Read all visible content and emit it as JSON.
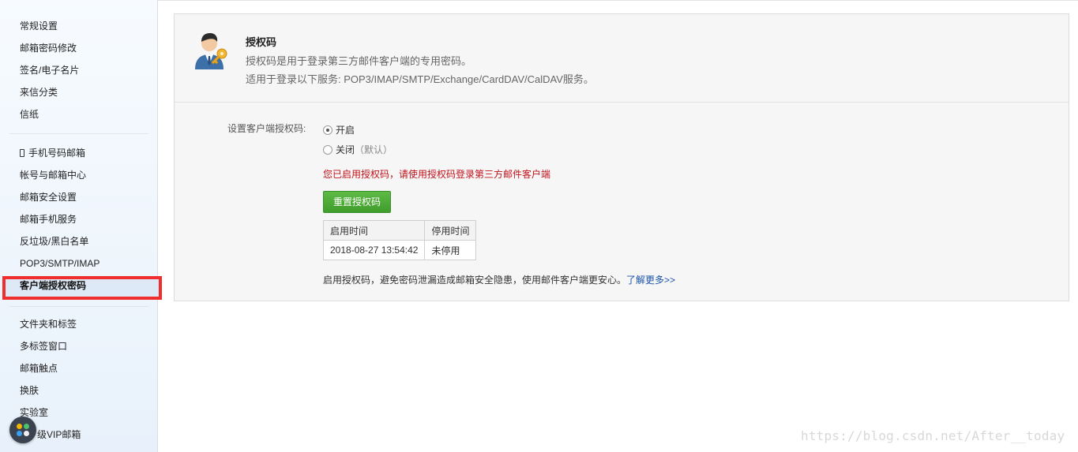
{
  "sidebar": {
    "group1": [
      "常规设置",
      "邮箱密码修改",
      "签名/电子名片",
      "来信分类",
      "信纸"
    ],
    "group2": [
      "手机号码邮箱",
      "帐号与邮箱中心",
      "邮箱安全设置",
      "邮箱手机服务",
      "反垃圾/黑白名单",
      "POP3/SMTP/IMAP",
      "客户端授权密码"
    ],
    "group3": [
      "文件夹和标签",
      "多标签窗口",
      "邮箱触点",
      "换肤",
      "实验室",
      "级VIP邮箱"
    ],
    "active_item": "客户端授权密码",
    "highlight_color": "#f02e2e"
  },
  "header": {
    "icon": "user-key-icon",
    "title": "授权码",
    "desc1": "授权码是用于登录第三方邮件客户端的专用密码。",
    "desc2": "适用于登录以下服务: POP3/IMAP/SMTP/Exchange/CardDAV/CalDAV服务。"
  },
  "form": {
    "label": "设置客户端授权码:",
    "option_on": "开启",
    "option_off": "关闭",
    "option_off_note": "（默认）",
    "selected": "开启",
    "warning": "您已启用授权码，请使用授权码登录第三方邮件客户端",
    "warning_color": "#c0121a",
    "reset_button": "重置授权码",
    "button_color": "#4aa932"
  },
  "time_table": {
    "headers": [
      "启用时间",
      "停用时间"
    ],
    "rows": [
      [
        "2018-08-27 13:54:42",
        "未停用"
      ]
    ]
  },
  "footer": {
    "note": "启用授权码，避免密码泄漏造成邮箱安全隐患，使用邮件客户端更安心。",
    "link": "了解更多>>"
  },
  "watermark": "https://blog.csdn.net/After__today"
}
